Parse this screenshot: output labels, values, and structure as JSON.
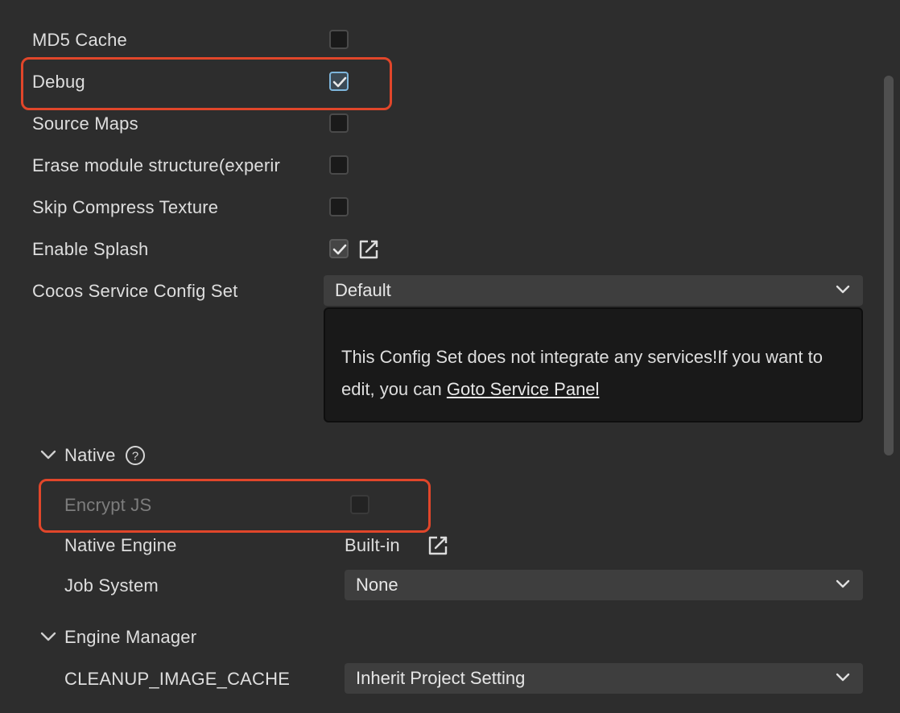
{
  "rows": {
    "md5_cache": {
      "label": "MD5 Cache",
      "checked": false
    },
    "debug": {
      "label": "Debug",
      "checked": true
    },
    "source_maps": {
      "label": "Source Maps",
      "checked": false
    },
    "erase_module": {
      "label": "Erase module structure(experir",
      "checked": false
    },
    "skip_compress": {
      "label": "Skip Compress Texture",
      "checked": false
    },
    "enable_splash": {
      "label": "Enable Splash",
      "checked": true
    },
    "service_config": {
      "label": "Cocos Service Config Set",
      "value": "Default"
    }
  },
  "info": {
    "text": "This Config Set does not integrate any services!If you want to edit, you can ",
    "link": "Goto Service Panel"
  },
  "native": {
    "title": "Native",
    "help": "?",
    "encrypt_js": {
      "label": "Encrypt JS",
      "checked": false,
      "disabled": true
    },
    "native_engine": {
      "label": "Native Engine",
      "value": "Built-in"
    },
    "job_system": {
      "label": "Job System",
      "value": "None"
    }
  },
  "engine_manager": {
    "title": "Engine Manager",
    "cleanup_cache": {
      "label": "CLEANUP_IMAGE_CACHE",
      "value": "Inherit Project Setting"
    }
  },
  "colors": {
    "background": "#2d2d2d",
    "highlight": "#e1462a",
    "focus": "#7eb6dc"
  },
  "icons": {
    "check": "check-icon",
    "edit": "edit-icon",
    "chevron": "chevron-down-icon",
    "help": "help-icon"
  }
}
